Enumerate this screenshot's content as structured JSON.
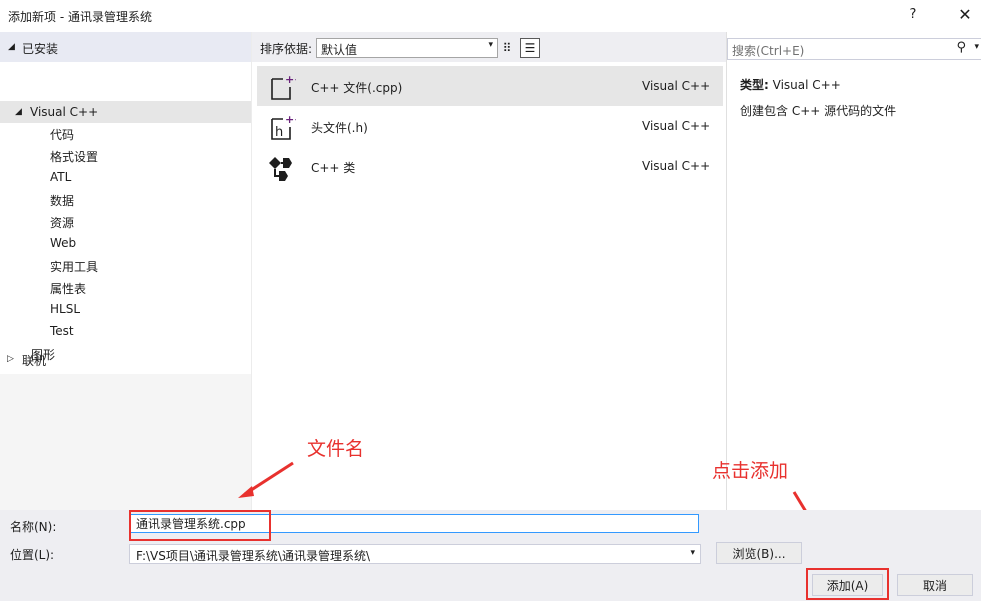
{
  "window": {
    "title": "添加新项 - 通讯录管理系统",
    "help_label": "?",
    "close_label": "✕"
  },
  "tree": {
    "installed": "已安装",
    "visual_cpp": "Visual C++",
    "children": [
      "代码",
      "格式设置",
      "ATL",
      "数据",
      "资源",
      "Web",
      "实用工具",
      "属性表",
      "HLSL",
      "Test"
    ],
    "graphics": "图形",
    "online": "联机"
  },
  "sortbar": {
    "label": "排序依据:",
    "value": "默认值"
  },
  "templates": [
    {
      "name": "C++ 文件(.cpp)",
      "lang": "Visual C++",
      "icon": "cpp-file-icon",
      "selected": true
    },
    {
      "name": "头文件(.h)",
      "lang": "Visual C++",
      "icon": "header-file-icon",
      "selected": false
    },
    {
      "name": "C++ 类",
      "lang": "Visual C++",
      "icon": "cpp-class-icon",
      "selected": false
    }
  ],
  "right": {
    "search_placeholder": "搜索(Ctrl+E)",
    "type_label": "类型:",
    "type_value": "Visual C++",
    "description": "创建包含 C++ 源代码的文件"
  },
  "annotations": {
    "filename": "文件名",
    "click_add": "点击添加"
  },
  "bottom": {
    "name_label": "名称(N):",
    "name_value": "通讯录管理系统.cpp",
    "location_label": "位置(L):",
    "location_value": "F:\\VS项目\\通讯录管理系统\\通讯录管理系统\\",
    "browse": "浏览(B)...",
    "add": "添加(A)",
    "cancel": "取消"
  },
  "colors": {
    "accent_purple": "#68217a",
    "annotation_red": "#e8312e",
    "input_focus": "#3399ff"
  }
}
